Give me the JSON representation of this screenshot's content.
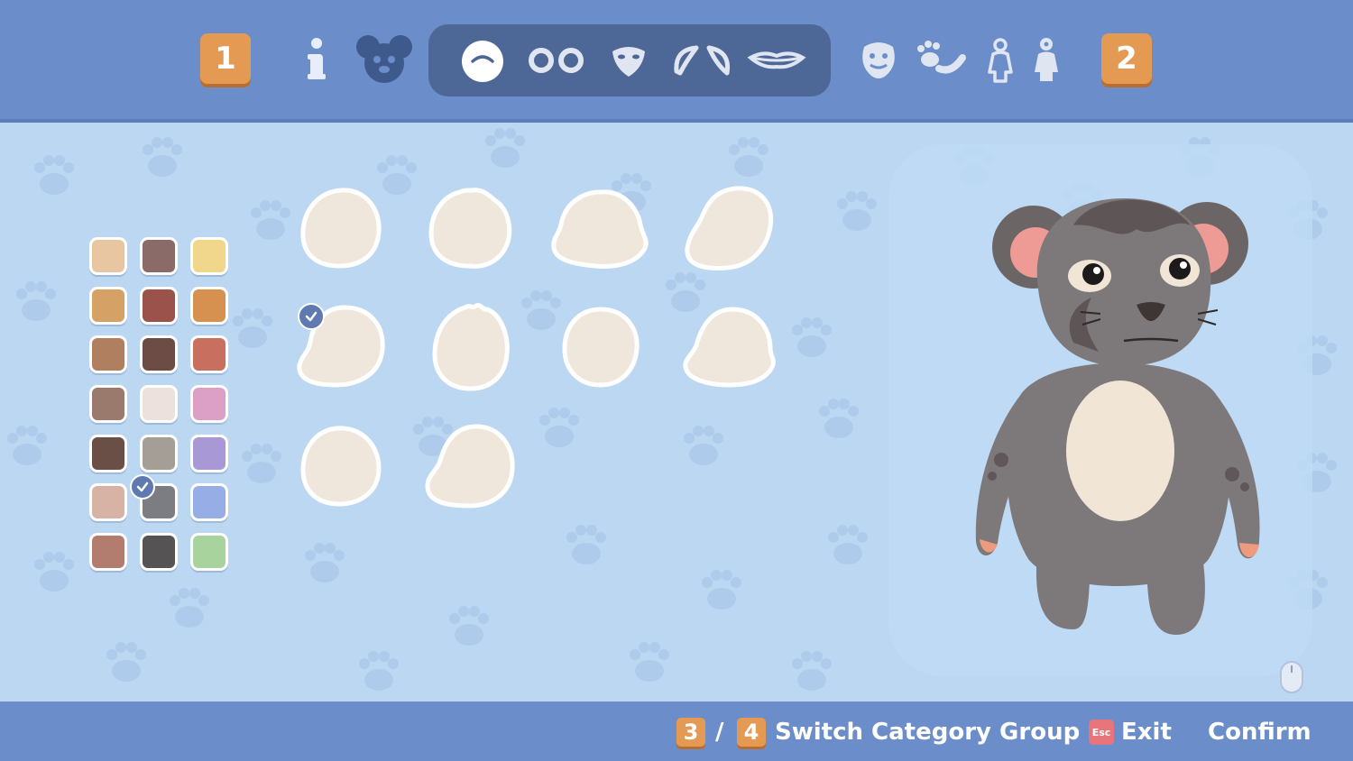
{
  "top_bar": {
    "left_key": "1",
    "right_key": "2",
    "icons": [
      "info-icon",
      "koala-face-icon",
      "head-shape-icon",
      "eyes-icon",
      "nose-icon",
      "ears-icon",
      "mouth-icon",
      "beard-icon",
      "paw-tail-icon",
      "body-outline-icon",
      "body-pattern-icon"
    ],
    "selected_icon": "head-shape-icon"
  },
  "color_palette": {
    "swatches": [
      "#e9c6a2",
      "#8b6b67",
      "#f0d78c",
      "#d6a165",
      "#9a524b",
      "#d6904f",
      "#b07f5f",
      "#6c4c44",
      "#c96f60",
      "#9a7a6c",
      "#ece1dd",
      "#dca0c6",
      "#6a4f46",
      "#a59e97",
      "#a998d6",
      "#d6b3a5",
      "#7b7d82",
      "#97ade6",
      "#b27c6f",
      "#565355",
      "#a9d39c"
    ],
    "selected_index": 16
  },
  "head_shapes": {
    "count": 10,
    "selected_index": 4
  },
  "colors": {
    "bar": "#6b8dc9",
    "accent_key": "#e49a52",
    "background": "#bcd7f2",
    "shape_fill": "#efe6dc",
    "koala_fur": "#7d7879",
    "koala_belly": "#f1e6d6",
    "ear_inner": "#ee9a95"
  },
  "footer": {
    "key_a": "3",
    "separator": "/",
    "key_b": "4",
    "switch_label": "Switch Category Group",
    "esc_key": "Esc",
    "exit_label": "Exit",
    "confirm_label": "Confirm"
  }
}
